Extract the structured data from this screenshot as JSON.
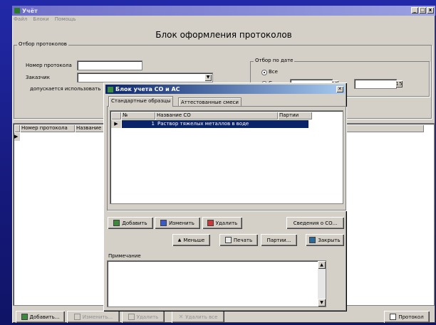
{
  "main_window": {
    "title": "Учёт",
    "controls": [
      "_",
      "□",
      "x"
    ],
    "menu": [
      "Файл",
      "Блоки",
      "Помощь"
    ],
    "heading": "Блок оформления протоколов"
  },
  "filter": {
    "group_title": "Отбор протоколов",
    "protocol_number_label": "Номер протокола",
    "protocol_number_value": "",
    "customer_label": "Заказчик",
    "customer_value": "",
    "allowed_label": "допускается использовать"
  },
  "date_filter": {
    "group_title": "Отбор по дате",
    "option_all": "Все",
    "option_range": "С"
  },
  "protocol_table": {
    "columns": [
      "Номер протокола",
      "Название"
    ],
    "rows": []
  },
  "bottom_bar": {
    "add": "Добавить...",
    "edit": "Изменить...",
    "delete": "Удалить",
    "delete_all": "Удалить все",
    "protocol": "Протокол"
  },
  "dialog": {
    "title": "Блок учета СО и АС",
    "tabs": [
      "Стандартные образцы",
      "Аттестованные смеси"
    ],
    "active_tab": 0,
    "columns": [
      "№",
      "Название СО",
      "Партии"
    ],
    "rows": [
      {
        "num": "1",
        "name": "Раствор тяжелых металлов в воде",
        "batches": "1"
      }
    ],
    "buttons": {
      "add": "Добавить",
      "edit": "Изменить",
      "delete": "Удалить",
      "info": "Сведения о СО...",
      "less": "Меньше",
      "print": "Печать",
      "batches": "Партии...",
      "close": "Закрыть"
    },
    "note_label": "Примечание",
    "note_value": ""
  }
}
